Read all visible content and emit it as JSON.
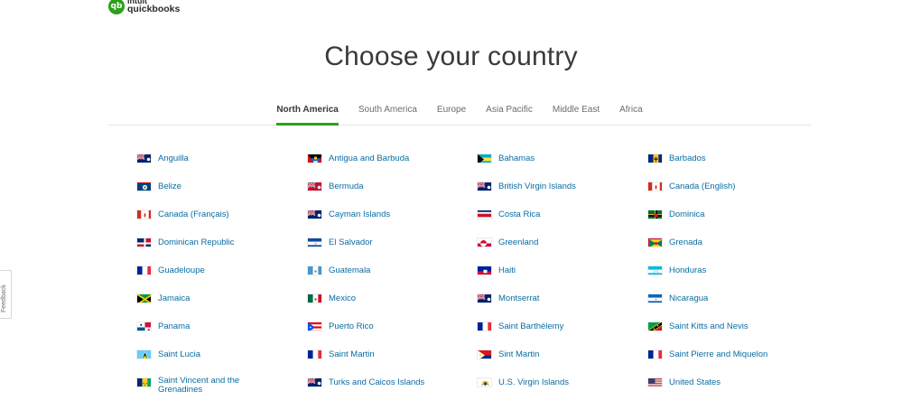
{
  "brand": {
    "line1": "intuit",
    "line2": "quickbooks",
    "badge": "qb"
  },
  "page_title": "Choose your country",
  "tabs": [
    {
      "label": "North America",
      "active": true
    },
    {
      "label": "South America",
      "active": false
    },
    {
      "label": "Europe",
      "active": false
    },
    {
      "label": "Asia Pacific",
      "active": false
    },
    {
      "label": "Middle East",
      "active": false
    },
    {
      "label": "Africa",
      "active": false
    }
  ],
  "countries": [
    [
      {
        "label": "Anguilla",
        "flag": "uk-ensign-blue"
      },
      {
        "label": "Belize",
        "flag": "belize"
      },
      {
        "label": "Canada (Français)",
        "flag": "canada"
      },
      {
        "label": "Dominican Republic",
        "flag": "dominican-republic"
      },
      {
        "label": "Guadeloupe",
        "flag": "france"
      },
      {
        "label": "Jamaica",
        "flag": "jamaica"
      },
      {
        "label": "Panama",
        "flag": "panama"
      },
      {
        "label": "Saint Lucia",
        "flag": "saint-lucia"
      },
      {
        "label": "Saint Vincent and the Grenadines",
        "flag": "saint-vincent"
      }
    ],
    [
      {
        "label": "Antigua and Barbuda",
        "flag": "antigua"
      },
      {
        "label": "Bermuda",
        "flag": "uk-ensign-red"
      },
      {
        "label": "Cayman Islands",
        "flag": "uk-ensign-blue"
      },
      {
        "label": "El Salvador",
        "flag": "el-salvador"
      },
      {
        "label": "Guatemala",
        "flag": "guatemala"
      },
      {
        "label": "Mexico",
        "flag": "mexico"
      },
      {
        "label": "Puerto Rico",
        "flag": "puerto-rico"
      },
      {
        "label": "Saint Martin",
        "flag": "france"
      },
      {
        "label": "Turks and Caicos Islands",
        "flag": "uk-ensign-blue"
      }
    ],
    [
      {
        "label": "Bahamas",
        "flag": "bahamas"
      },
      {
        "label": "British Virgin Islands",
        "flag": "uk-ensign-blue"
      },
      {
        "label": "Costa Rica",
        "flag": "costa-rica"
      },
      {
        "label": "Greenland",
        "flag": "greenland"
      },
      {
        "label": "Haiti",
        "flag": "haiti"
      },
      {
        "label": "Montserrat",
        "flag": "uk-ensign-blue"
      },
      {
        "label": "Saint Barthélemy",
        "flag": "france"
      },
      {
        "label": "Sint Martin",
        "flag": "sint-maarten"
      },
      {
        "label": "U.S. Virgin Islands",
        "flag": "usvi"
      }
    ],
    [
      {
        "label": "Barbados",
        "flag": "barbados"
      },
      {
        "label": "Canada (English)",
        "flag": "canada"
      },
      {
        "label": "Dominica",
        "flag": "dominica"
      },
      {
        "label": "Grenada",
        "flag": "grenada"
      },
      {
        "label": "Honduras",
        "flag": "honduras"
      },
      {
        "label": "Nicaragua",
        "flag": "nicaragua"
      },
      {
        "label": "Saint Kitts and Nevis",
        "flag": "saint-kitts"
      },
      {
        "label": "Saint Pierre and Miquelon",
        "flag": "france"
      },
      {
        "label": "United States",
        "flag": "usa"
      }
    ]
  ],
  "feedback": {
    "label": "Feedback"
  },
  "colors": {
    "accent": "#2ca01c",
    "link": "#0a6ca2",
    "title": "#393a3d",
    "tab_inactive": "#6b6c72",
    "divider": "#e3e5e8"
  }
}
